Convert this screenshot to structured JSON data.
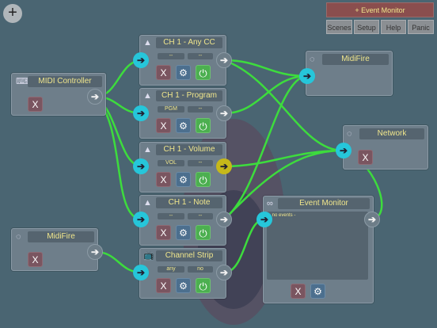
{
  "add_button_label": "+",
  "toolbar": {
    "event_monitor_label": "+ Event Monitor",
    "scenes_label": "Scenes",
    "setup_label": "Setup",
    "help_label": "Help",
    "panic_label": "Panic"
  },
  "nodes": {
    "midi_controller": {
      "title": "MIDI Controller",
      "icon": "keyboard-icon"
    },
    "midifire_in": {
      "title": "MidiFire",
      "icon": "midi-port-icon"
    },
    "ch1_any_cc": {
      "title": "CH 1 - Any CC",
      "params": [
        "--",
        "--"
      ],
      "icon": "shark-fin-icon"
    },
    "ch1_program": {
      "title": "CH 1 - Program",
      "params": [
        "PGM",
        "--"
      ],
      "icon": "shark-fin-icon"
    },
    "ch1_volume": {
      "title": "CH  1 - Volume",
      "params": [
        "VOL",
        "--"
      ],
      "icon": "shark-fin-icon"
    },
    "ch1_note": {
      "title": "CH 1 - Note",
      "params": [
        "--",
        "--"
      ],
      "icon": "shark-fin-icon"
    },
    "channel_strip": {
      "title": "Channel Strip",
      "params": [
        "any",
        "no"
      ],
      "icon": "tv-icon"
    },
    "midifire_out": {
      "title": "MidiFire",
      "icon": "midi-port-icon"
    },
    "network": {
      "title": "Network",
      "icon": "midi-port-icon"
    },
    "event_monitor": {
      "title": "Event Monitor",
      "content": "- no events -",
      "icon": "infinity-icon"
    }
  },
  "glyphs": {
    "close": "X",
    "gear": "⚙",
    "power": "⏻",
    "arrow": "➔"
  },
  "colors": {
    "background": "#4a6572",
    "wire": "#3ddc3d",
    "port_in": "#26c6da",
    "title_text": "#f0e68c",
    "power": "#4caf50"
  }
}
